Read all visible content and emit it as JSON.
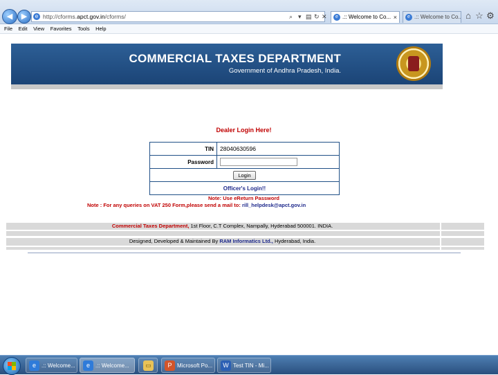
{
  "browser": {
    "url_prefix": "http://cforms.",
    "url_domain": "apct.gov.in",
    "url_suffix": "/cforms/",
    "tabs": [
      {
        "label": ".:: Welcome to Co...",
        "close": "×"
      },
      {
        "label": ".:: Welcome to Co..."
      }
    ],
    "menu": [
      "File",
      "Edit",
      "View",
      "Favorites",
      "Tools",
      "Help"
    ]
  },
  "banner": {
    "title": "COMMERCIAL TAXES DEPARTMENT",
    "subtitle": "Government of Andhra Pradesh, India."
  },
  "login": {
    "heading": "Dealer Login Here!",
    "tin_label": "TIN",
    "tin_value": "28040630596",
    "password_label": "Password",
    "login_button": "Login",
    "officer_link": "Officer's Login!!"
  },
  "notes": {
    "note1": "Note: Use eReturn Password",
    "note2_text": "Note : For any queries on VAT 250 Form,please send a mail to: ",
    "note2_email": "rill_helpdesk@apct.gov.in"
  },
  "footer": {
    "line1_highlight": "Commercial Taxes Department,",
    "line1_rest": " 1st Floor, C.T Complex, Nampally, Hyderabad 500001. INDIA.",
    "line2_start": "Designed, Developed & Maintained By ",
    "line2_company": "RAM Informatics Ltd.,",
    "line2_end": " Hyderabad, India."
  },
  "taskbar": {
    "items": [
      {
        "label": ".:: Welcome...",
        "icon": "ie-icon",
        "active": false
      },
      {
        "label": ".:: Welcome...",
        "icon": "ie-icon",
        "active": true
      },
      {
        "label": "",
        "icon": "folder-icon",
        "active": false
      },
      {
        "label": "Microsoft Po...",
        "icon": "powerpoint-icon",
        "active": false
      },
      {
        "label": "Test TIN - Mi...",
        "icon": "word-icon",
        "active": false
      }
    ]
  },
  "colors": {
    "banner": "#1f4f86",
    "accent_red": "#c00000",
    "link_blue": "#1f2a8c"
  }
}
